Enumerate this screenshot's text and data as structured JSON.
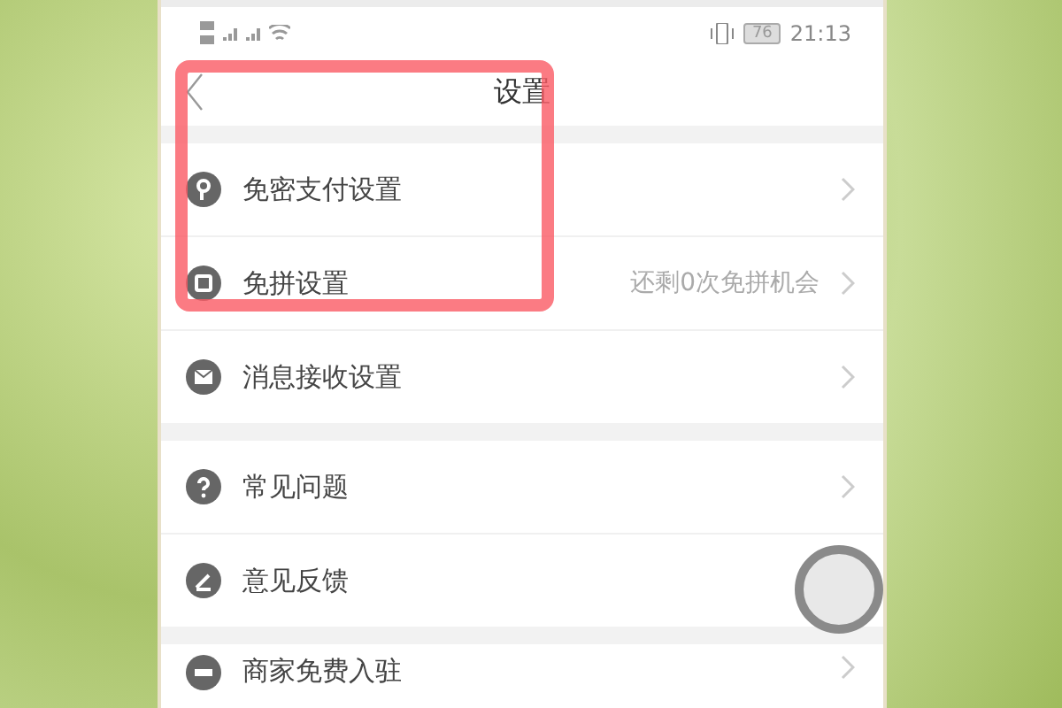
{
  "status_bar": {
    "battery": "76",
    "time": "21:13"
  },
  "header": {
    "title": "设置"
  },
  "sections": [
    {
      "items": [
        {
          "kind": "key",
          "label": "免密支付设置"
        },
        {
          "kind": "coupon",
          "label": "免拼设置",
          "value": "还剩0次免拼机会"
        },
        {
          "kind": "mail",
          "label": "消息接收设置"
        }
      ]
    },
    {
      "items": [
        {
          "kind": "question",
          "label": "常见问题"
        },
        {
          "kind": "pen",
          "label": "意见反馈"
        }
      ]
    },
    {
      "items": [
        {
          "kind": "store",
          "label": "商家免费入驻"
        }
      ]
    }
  ]
}
